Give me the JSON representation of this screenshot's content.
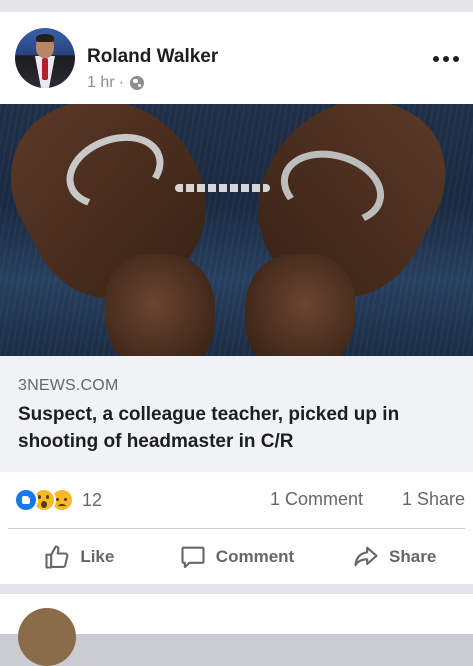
{
  "post": {
    "author": "Roland Walker",
    "time": "1 hr",
    "separator": "·",
    "privacy_icon": "globe-icon",
    "more_icon": "more-dots-icon"
  },
  "link": {
    "domain": "3NEWS.COM",
    "title": "Suspect, a colleague teacher, picked up in shooting of headmaster in C/R"
  },
  "stats": {
    "reactions": [
      "like",
      "wow",
      "sad"
    ],
    "reaction_count": "12",
    "comments": "1 Comment",
    "shares": "1 Share"
  },
  "actions": {
    "like": "Like",
    "comment": "Comment",
    "share": "Share"
  },
  "colors": {
    "like_blue": "#1877f2",
    "emoji_yellow": "#f7b928",
    "secondary_text": "#65676b",
    "primary_text": "#1c1e21"
  }
}
